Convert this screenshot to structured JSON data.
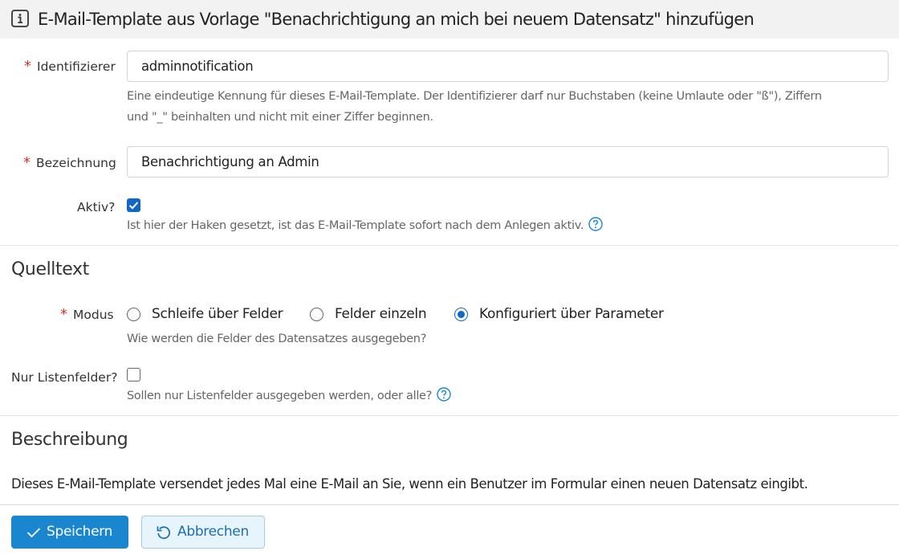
{
  "header": {
    "title": "E-Mail-Template aus Vorlage \"Benachrichtigung an mich bei neuem Datensatz\" hinzufügen",
    "icon": "info-icon"
  },
  "form": {
    "identifier": {
      "label": "Identifizierer",
      "required": true,
      "value": "adminnotification",
      "help_line1": "Eine eindeutige Kennung für dieses E-Mail-Template. Der Identifizierer darf nur Buchstaben (keine Umlaute oder \"ß\"), Ziffern",
      "help_line2": "und \"_\" beinhalten und nicht mit einer Ziffer beginnen."
    },
    "name": {
      "label": "Bezeichnung",
      "required": true,
      "value": "Benachrichtigung an Admin"
    },
    "active": {
      "label": "Aktiv?",
      "checked": true,
      "help": "Ist hier der Haken gesetzt, ist das E-Mail-Template sofort nach dem Anlegen aktiv."
    }
  },
  "source": {
    "title": "Quelltext",
    "mode": {
      "label": "Modus",
      "required": true,
      "options": [
        "Schleife über Felder",
        "Felder einzeln",
        "Konfiguriert über Parameter"
      ],
      "selected": "Konfiguriert über Parameter",
      "help": "Wie werden die Felder des Datensatzes ausgegeben?"
    },
    "list_fields": {
      "label": "Nur Listenfelder?",
      "checked": false,
      "help": "Sollen nur Listenfelder ausgegeben werden, oder alle?"
    }
  },
  "description": {
    "title": "Beschreibung",
    "text": "Dieses E-Mail-Template versendet jedes Mal eine E-Mail an Sie, wenn ein Benutzer im Formular einen neuen Datensatz eingibt."
  },
  "buttons": {
    "save": "Speichern",
    "cancel": "Abbrechen"
  },
  "colors": {
    "primary": "#1a86d0",
    "required": "#d9342b",
    "help_icon": "#1a86d0"
  }
}
